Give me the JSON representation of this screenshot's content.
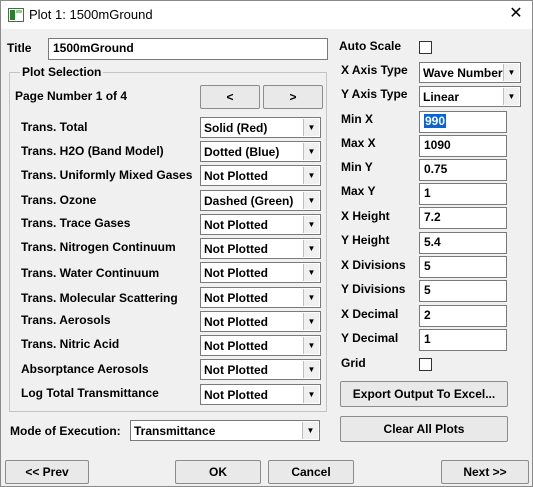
{
  "window": {
    "title": "Plot 1: 1500mGround",
    "close_icon": "close-icon"
  },
  "title_field": {
    "label": "Title",
    "value": "1500mGround"
  },
  "plot_selection": {
    "group_label": "Plot Selection",
    "page_label": "Page Number 1 of 4",
    "prev_page": "<",
    "next_page": ">",
    "rows": [
      {
        "label": "Trans. Total",
        "value": "Solid (Red)"
      },
      {
        "label": "Trans. H2O (Band Model)",
        "value": "Dotted (Blue)"
      },
      {
        "label": "Trans. Uniformly Mixed Gases",
        "value": "Not Plotted"
      },
      {
        "label": "Trans. Ozone",
        "value": "Dashed (Green)"
      },
      {
        "label": "Trans. Trace Gases",
        "value": "Not Plotted"
      },
      {
        "label": "Trans. Nitrogen Continuum",
        "value": "Not Plotted"
      },
      {
        "label": "Trans. Water Continuum",
        "value": "Not Plotted"
      },
      {
        "label": "Trans. Molecular Scattering",
        "value": "Not Plotted"
      },
      {
        "label": "Trans. Aerosols",
        "value": "Not Plotted"
      },
      {
        "label": "Trans. Nitric Acid",
        "value": "Not Plotted"
      },
      {
        "label": "Absorptance Aerosols",
        "value": "Not Plotted"
      },
      {
        "label": "Log Total Transmittance",
        "value": "Not Plotted"
      }
    ]
  },
  "mode": {
    "label": "Mode of Execution:",
    "value": "Transmittance"
  },
  "axes": {
    "auto_scale_label": "Auto Scale",
    "x_axis_type_label": "X Axis Type",
    "x_axis_type_value": "Wave Number",
    "y_axis_type_label": "Y Axis Type",
    "y_axis_type_value": "Linear",
    "fields": [
      {
        "label": "Min X",
        "value": "990"
      },
      {
        "label": "Max X",
        "value": "1090"
      },
      {
        "label": "Min Y",
        "value": "0.75"
      },
      {
        "label": "Max Y",
        "value": "1"
      },
      {
        "label": "X Height",
        "value": "7.2"
      },
      {
        "label": "Y Height",
        "value": "5.4"
      },
      {
        "label": "X Divisions",
        "value": "5"
      },
      {
        "label": "Y Divisions",
        "value": "5"
      },
      {
        "label": "X Decimal",
        "value": "2"
      },
      {
        "label": "Y Decimal",
        "value": "1"
      }
    ],
    "grid_label": "Grid"
  },
  "buttons": {
    "export": "Export Output To Excel...",
    "clear": "Clear All Plots",
    "prev": "<< Prev",
    "ok": "OK",
    "cancel": "Cancel",
    "next": "Next >>"
  }
}
